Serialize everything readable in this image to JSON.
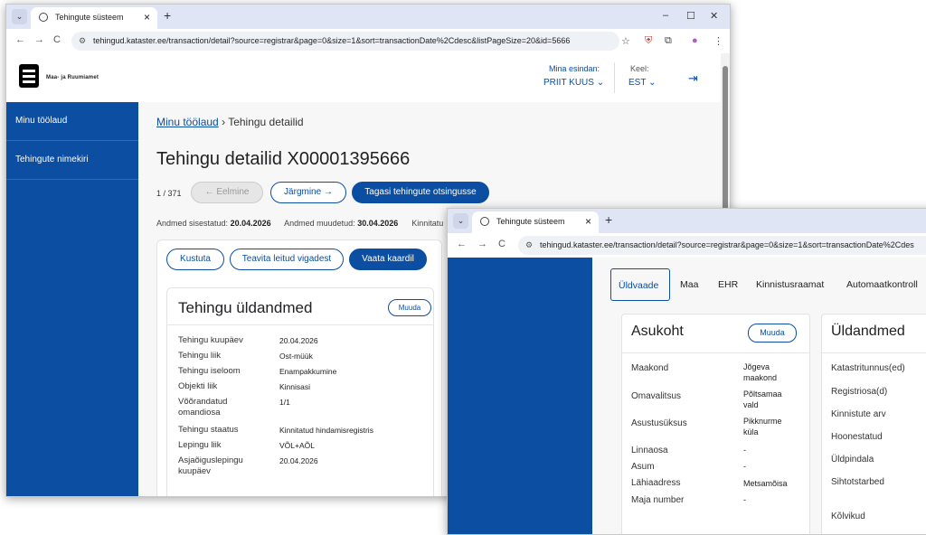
{
  "browser": {
    "tab_title": "Tehingute süsteem",
    "url": "tehingud.kataster.ee/transaction/detail?source=registrar&page=0&size=1&sort=transactionDate%2Cdesc&listPageSize=20&id=5666",
    "url_truncated": "tehingud.kataster.ee/transaction/detail?source=registrar&page=0&size=1&sort=transactionDate%2Cdes"
  },
  "header": {
    "logo_text": "Maa- ja Ruumiamet",
    "represent_label": "Mina esindan:",
    "represent_value": "PRIIT KUUS",
    "lang_label": "Keel:",
    "lang_value": "EST"
  },
  "sidebar": {
    "items": [
      {
        "label": "Minu töölaud"
      },
      {
        "label": "Tehingute nimekiri"
      }
    ]
  },
  "main": {
    "breadcrumb_link": "Minu töölaud",
    "breadcrumb_current": "Tehingu detailid",
    "title": "Tehingu detailid X00001395666",
    "pager": "1 / 371",
    "prev_label": "← Eelmine",
    "next_label": "Järgmine →",
    "back_label": "Tagasi tehingute otsingusse",
    "meta": {
      "entered_label": "Andmed sisestatud:",
      "entered_value": "20.04.2026",
      "modified_label": "Andmed muudetud:",
      "modified_value": "30.04.2026",
      "extra_label": "Kinnitatu"
    },
    "actions": {
      "delete": "Kustuta",
      "report": "Teavita leitud vigadest",
      "map": "Vaata kaardil"
    },
    "general": {
      "title": "Tehingu üldandmed",
      "edit": "Muuda",
      "rows": [
        {
          "label": "Tehingu kuupäev",
          "value": "20.04.2026"
        },
        {
          "label": "Tehingu liik",
          "value": "Ost-müük"
        },
        {
          "label": "Tehingu iseloom",
          "value": "Enampakkumine"
        },
        {
          "label": "Objekti liik",
          "value": "Kinnisasi"
        },
        {
          "label": "Võõrandatud omandiosa",
          "value": "1/1"
        },
        {
          "label": "Tehingu staatus",
          "value": "Kinnitatud hindamisregistris"
        },
        {
          "label": "Lepingu liik",
          "value": "VÕL+AÕL"
        },
        {
          "label": "Asjaõiguslepingu kuupäev",
          "value": "20.04.2026"
        }
      ]
    }
  },
  "second": {
    "tabs": [
      {
        "label": "Üldvaade"
      },
      {
        "label": "Maa"
      },
      {
        "label": "EHR"
      },
      {
        "label": "Kinnistusraamat"
      },
      {
        "label": "Automaatkontroll"
      }
    ],
    "location": {
      "title": "Asukoht",
      "edit": "Muuda",
      "rows": [
        {
          "label": "Maakond",
          "value": "Jõgeva maakond"
        },
        {
          "label": "Omavalitsus",
          "value": "Põltsamaa vald"
        },
        {
          "label": "Asustusüksus",
          "value": "Pikknurme küla"
        },
        {
          "label": "Linnaosa",
          "value": "-"
        },
        {
          "label": "Asum",
          "value": "-"
        },
        {
          "label": "Lähiaadress",
          "value": "Metsamõisa"
        },
        {
          "label": "Maja number",
          "value": "-"
        }
      ]
    },
    "general": {
      "title": "Üldandmed",
      "rows": [
        {
          "label": "Katastritunnus(ed)"
        },
        {
          "label": "Registriosa(d)"
        },
        {
          "label": "Kinnistute arv"
        },
        {
          "label": "Hoonestatud"
        },
        {
          "label": "Üldpindala"
        },
        {
          "label": "Sihtotstarbed"
        },
        {
          "label": "Kõlvikud"
        }
      ]
    }
  }
}
